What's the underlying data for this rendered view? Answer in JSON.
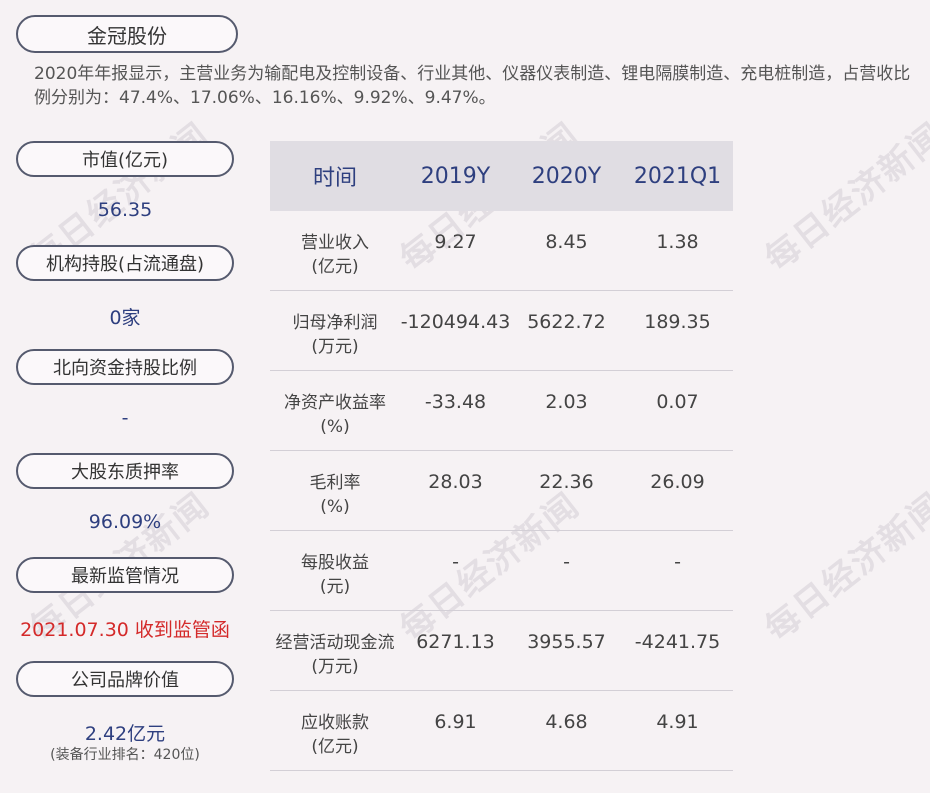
{
  "title": "金冠股份",
  "summary": "2020年年报显示，主营业务为输配电及控制设备、行业其他、仪器仪表制造、锂电隔膜制造、充电桩制造，占营收比例分别为：47.4%、17.06%、16.16%、9.92%、9.47%。",
  "sidebar": [
    {
      "label": "市值(亿元)",
      "value": "56.35"
    },
    {
      "label": "机构持股(占流通盘)",
      "value": "0家"
    },
    {
      "label": "北向资金持股比例",
      "value": "-"
    },
    {
      "label": "大股东质押率",
      "value": "96.09%"
    },
    {
      "label": "最新监管情况",
      "value": "2021.07.30 收到监管函"
    },
    {
      "label": "公司品牌价值",
      "value": "2.42亿元",
      "note": "(装备行业排名：420位)"
    }
  ],
  "table": {
    "headers": [
      "时间",
      "2019Y",
      "2020Y",
      "2021Q1"
    ],
    "rows": [
      {
        "label1": "营业收入",
        "label2": "(亿元)",
        "values": [
          "9.27",
          "8.45",
          "1.38"
        ]
      },
      {
        "label1": "归母净利润",
        "label2": "(万元)",
        "values": [
          "-120494.43",
          "5622.72",
          "189.35"
        ]
      },
      {
        "label1": "净资产收益率",
        "label2": "(%)",
        "values": [
          "-33.48",
          "2.03",
          "0.07"
        ]
      },
      {
        "label1": "毛利率",
        "label2": "(%)",
        "values": [
          "28.03",
          "22.36",
          "26.09"
        ]
      },
      {
        "label1": "每股收益",
        "label2": "(元)",
        "values": [
          "-",
          "-",
          "-"
        ]
      },
      {
        "label1": "经营活动现金流",
        "label2": "(万元)",
        "values": [
          "6271.13",
          "3955.57",
          "-4241.75"
        ]
      },
      {
        "label1": "应收账款",
        "label2": "(亿元)",
        "values": [
          "6.91",
          "4.68",
          "4.91"
        ]
      }
    ]
  },
  "watermark": "每日经济新闻"
}
